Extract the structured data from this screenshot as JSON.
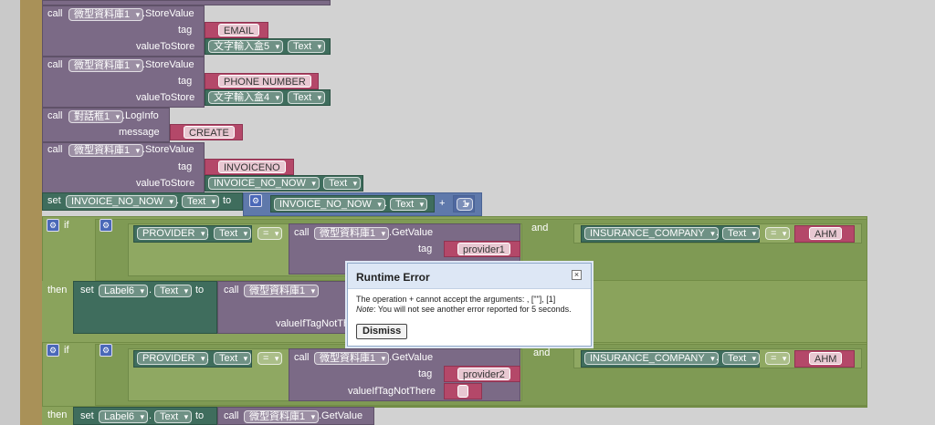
{
  "blocks": {
    "call": "call",
    "store_value": ".StoreValue",
    "get_value": ".GetValue",
    "log_info": ".LogInfo",
    "tag": "tag",
    "value_to_store": "valueToStore",
    "message": "message",
    "value_if_tag_not_there": "valueIfTagNotThere",
    "set": "set",
    "to": "to",
    "if": "if",
    "then": "then",
    "and": "and",
    "eq": "=",
    "plus": "+",
    "dot": ".",
    "q_open": "\"",
    "q_close": "\"",
    "tinydb": "微型資料庫1",
    "notifier": "對話框1",
    "tb5": "文字輸入盒5",
    "tb4": "文字輸入盒4",
    "text_prop": "Text",
    "email": "EMAIL",
    "phone": "PHONE NUMBER",
    "create": "CREATE",
    "invoiceno": "INVOICENO",
    "invoice_now": "INVOICE_NO_NOW",
    "one": "1",
    "provider": "PROVIDER",
    "provider1": "provider1",
    "provider2": "provider2",
    "insurance": "INSURANCE_COMPANY",
    "ahm": "AHM",
    "label6": "Label6"
  },
  "dialog": {
    "title": "Runtime Error",
    "line1": "The operation + cannot accept the arguments: , [\"\"], [1]",
    "note_label": "Note",
    "note_text": ": You will not see another error reported for 5 seconds.",
    "dismiss": "Dismiss",
    "close_glyph": "×"
  }
}
